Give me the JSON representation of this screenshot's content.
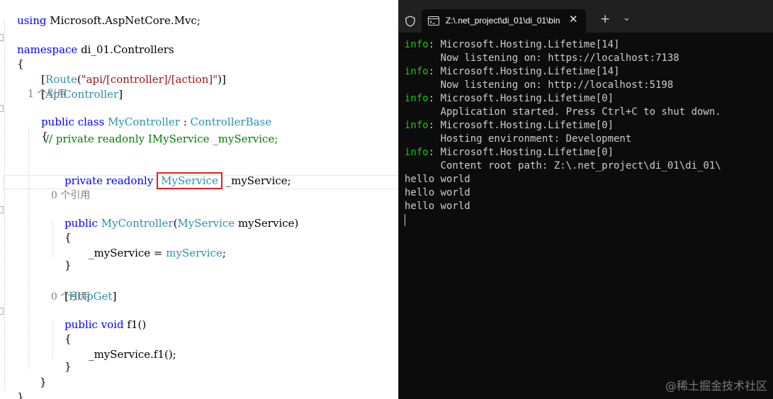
{
  "editor": {
    "using_kw": "using",
    "using_ns": " Microsoft.AspNetCore.Mvc;",
    "namespace_kw": "namespace",
    "namespace_name": " di_01.Controllers",
    "brace_open": "{",
    "route_attr": "Route",
    "route_arg": "\"api/[controller]/[action]\"",
    "apicontroller_attr": "ApiController",
    "ref_1": "1 个引用",
    "public_kw": "public",
    "class_kw": "class",
    "class_name": "MyController",
    "base_class": "ControllerBase",
    "comment_line": "// private readonly IMyService _myService;",
    "private_kw": "private",
    "readonly_kw": "readonly",
    "field_type": "MyService",
    "field_name": " _myService;",
    "ref_0a": "0 个引用",
    "ctor_name": "MyController",
    "ctor_param_type": "MyService",
    "ctor_param_name": " myService)",
    "assign_line": "_myService = ",
    "assign_value": "myService",
    "assign_end": ";",
    "httpget_attr": "HttpGet",
    "ref_0b": "0 个引用",
    "void_kw": "void",
    "method_name": " f1()",
    "call_line": "_myService.f1();",
    "brace_close": "}"
  },
  "terminal": {
    "tab_title": "Z:\\.net_project\\di_01\\di_01\\bin",
    "new_tab_label": "+",
    "dropdown_label": "⌄",
    "close_label": "✕",
    "lines": [
      {
        "level": "info",
        "text": ": Microsoft.Hosting.Lifetime[14]"
      },
      {
        "level": "",
        "text": "      Now listening on: https://localhost:7138"
      },
      {
        "level": "info",
        "text": ": Microsoft.Hosting.Lifetime[14]"
      },
      {
        "level": "",
        "text": "      Now listening on: http://localhost:5198"
      },
      {
        "level": "info",
        "text": ": Microsoft.Hosting.Lifetime[0]"
      },
      {
        "level": "",
        "text": "      Application started. Press Ctrl+C to shut down."
      },
      {
        "level": "info",
        "text": ": Microsoft.Hosting.Lifetime[0]"
      },
      {
        "level": "",
        "text": "      Hosting environment: Development"
      },
      {
        "level": "info",
        "text": ": Microsoft.Hosting.Lifetime[0]"
      },
      {
        "level": "",
        "text": "      Content root path: Z:\\.net_project\\di_01\\di_01\\"
      },
      {
        "level": "",
        "text": "hello world"
      },
      {
        "level": "",
        "text": "hello world"
      },
      {
        "level": "",
        "text": "hello world"
      }
    ]
  },
  "watermark": "@稀土掘金技术社区",
  "colors": {
    "keyword": "#0000ff",
    "type": "#2b91af",
    "string": "#a31515",
    "comment": "#008000",
    "info": "#16c60c",
    "highlight_box": "#e02020",
    "terminal_bg": "#0c0c0c"
  }
}
